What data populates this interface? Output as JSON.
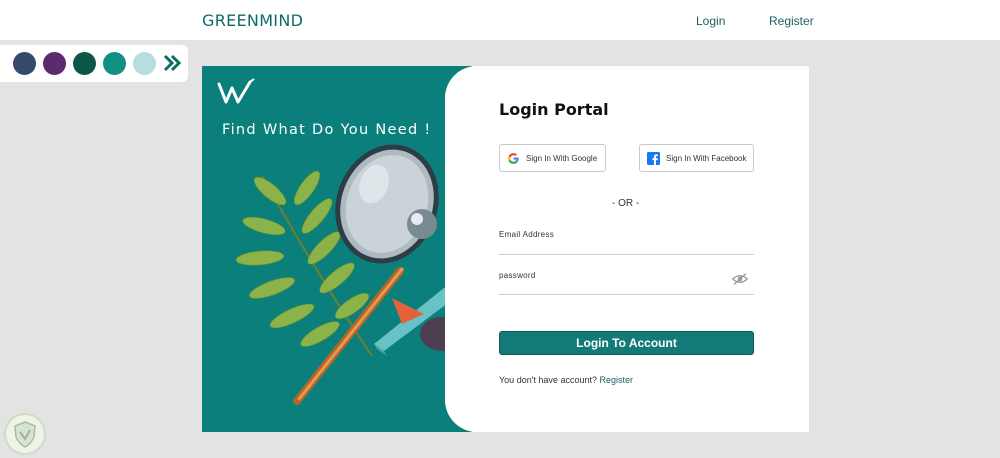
{
  "header": {
    "brand": "GREENMIND",
    "nav": [
      {
        "label": "Login"
      },
      {
        "label": "Register"
      }
    ]
  },
  "palette": {
    "swatches": [
      "#35496a",
      "#5b2b6e",
      "#0e5747",
      "#128f85",
      "#b6dde0"
    ],
    "more_icon": "double-chevron-right-icon"
  },
  "art": {
    "heading": "Find What Do You Need !",
    "logo_icon": "w-logo-icon",
    "background": "#0a7f7b"
  },
  "login": {
    "title": "Login Portal",
    "google_label": "Sign In With Google",
    "facebook_label": "Sign In With Facebook",
    "or_text": "- OR -",
    "email_label": "Email Address",
    "email_value": "",
    "password_label": "password",
    "password_value": "",
    "submit_label": "Login To Account",
    "footer_prefix": "You don't have account?",
    "footer_link": "Register",
    "accent": "#137a77"
  }
}
